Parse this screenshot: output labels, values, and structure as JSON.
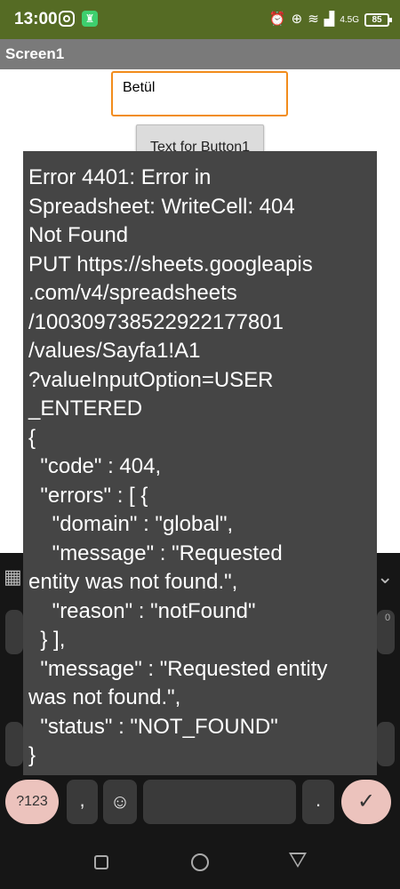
{
  "status_bar": {
    "time": "13:00",
    "network": "4.5G",
    "battery": "85",
    "icons": [
      "instagram-icon",
      "app-notification-icon",
      "alarm-icon",
      "data-saver-icon",
      "wifi-icon",
      "signal-icon",
      "battery-icon"
    ]
  },
  "app": {
    "screen_title": "Screen1",
    "text_input_value": "Betül",
    "button_label": "Text for Button1"
  },
  "error_toast": {
    "lines": [
      "Error 4401: Error in",
      "Spreadsheet: WriteCell: 404",
      "Not Found",
      "PUT https://sheets.googleapis",
      ".com/v4/spreadsheets",
      "/100309738522922177801",
      "/values/Sayfa1!A1",
      "?valueInputOption=USER",
      "_ENTERED",
      "{",
      "  \"code\" : 404,",
      "  \"errors\" : [ {",
      "    \"domain\" : \"global\",",
      "    \"message\" : \"Requested",
      "entity was not found.\",",
      "    \"reason\" : \"notFound\"",
      "  } ],",
      "  \"message\" : \"Requested entity",
      "was not found.\",",
      "  \"status\" : \"NOT_FOUND\"",
      "}"
    ]
  },
  "keyboard": {
    "symbols_key": "?123",
    "comma_key": ",",
    "emoji_key": "☺",
    "period_key": ".",
    "enter_key": "✓",
    "partial_number_hint": "0",
    "accent_color": "#ecc3bd"
  },
  "colors": {
    "status_bar": "#556b24",
    "title_bar": "#7a7a7a",
    "input_border": "#f28c1c",
    "toast_bg": "#454545"
  }
}
